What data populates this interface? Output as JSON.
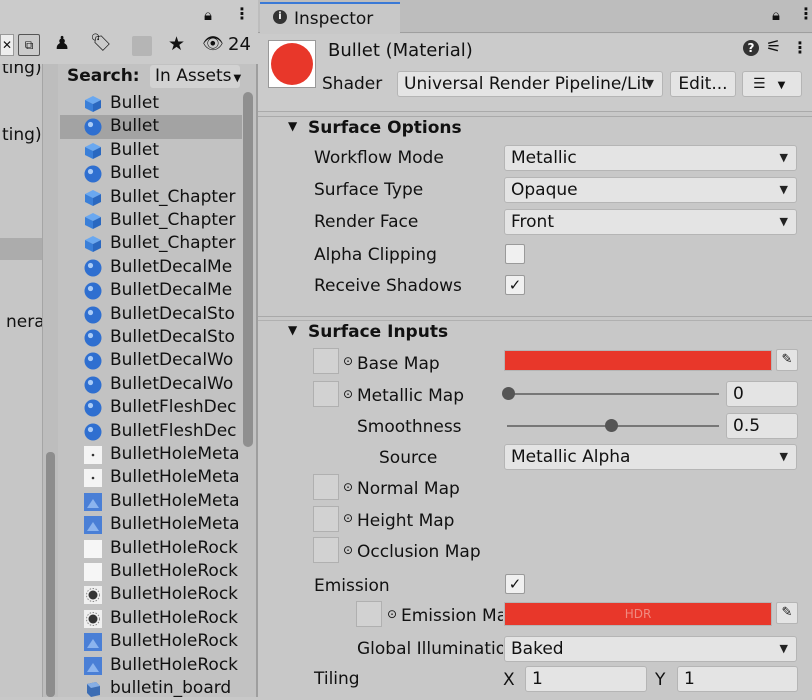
{
  "left": {
    "toolbar": {
      "hidden_count": "24"
    },
    "clipped_labels": [
      "ting)",
      "ting)",
      "nera"
    ],
    "search_label": "Search:",
    "search_scope": "In Assets",
    "assets": [
      {
        "name": "Bullet",
        "icon": "prefab-cube-icon"
      },
      {
        "name": "Bullet",
        "icon": "material-sphere-icon",
        "selected": true
      },
      {
        "name": "Bullet",
        "icon": "prefab-cube-icon"
      },
      {
        "name": "Bullet",
        "icon": "material-sphere-icon"
      },
      {
        "name": "Bullet_Chapter",
        "icon": "prefab-cube-icon"
      },
      {
        "name": "Bullet_Chapter",
        "icon": "prefab-cube-icon"
      },
      {
        "name": "Bullet_Chapter",
        "icon": "prefab-cube-icon"
      },
      {
        "name": "BulletDecalMe",
        "icon": "material-sphere-icon"
      },
      {
        "name": "BulletDecalMe",
        "icon": "material-sphere-icon"
      },
      {
        "name": "BulletDecalSto",
        "icon": "material-sphere-icon"
      },
      {
        "name": "BulletDecalSto",
        "icon": "material-sphere-icon"
      },
      {
        "name": "BulletDecalWo",
        "icon": "material-sphere-icon"
      },
      {
        "name": "BulletDecalWo",
        "icon": "material-sphere-icon"
      },
      {
        "name": "BulletFleshDec",
        "icon": "material-sphere-icon"
      },
      {
        "name": "BulletFleshDec",
        "icon": "material-sphere-icon"
      },
      {
        "name": "BulletHoleMeta",
        "icon": "texture-dot-icon"
      },
      {
        "name": "BulletHoleMeta",
        "icon": "texture-dot-icon"
      },
      {
        "name": "BulletHoleMeta",
        "icon": "texture-blue-icon"
      },
      {
        "name": "BulletHoleMeta",
        "icon": "texture-blue-icon"
      },
      {
        "name": "BulletHoleRock",
        "icon": "texture-white-icon"
      },
      {
        "name": "BulletHoleRock",
        "icon": "texture-white-icon"
      },
      {
        "name": "BulletHoleRock",
        "icon": "texture-hole-icon"
      },
      {
        "name": "BulletHoleRock",
        "icon": "texture-hole-icon"
      },
      {
        "name": "BulletHoleRock",
        "icon": "texture-blue-icon"
      },
      {
        "name": "BulletHoleRock",
        "icon": "texture-blue-icon"
      },
      {
        "name": "bulletin_board",
        "icon": "model-icon"
      }
    ]
  },
  "inspector": {
    "tab": "Inspector",
    "title": "Bullet (Material)",
    "shader_label": "Shader",
    "shader_value": "Universal Render Pipeline/Lit",
    "edit_button": "Edit...",
    "colors": {
      "albedo": "#e8372a",
      "emission": "#e8372a"
    },
    "surface_options": {
      "header": "Surface Options",
      "workflow_mode": {
        "label": "Workflow Mode",
        "value": "Metallic"
      },
      "surface_type": {
        "label": "Surface Type",
        "value": "Opaque"
      },
      "render_face": {
        "label": "Render Face",
        "value": "Front"
      },
      "alpha_clipping": {
        "label": "Alpha Clipping",
        "checked": false
      },
      "receive_shadows": {
        "label": "Receive Shadows",
        "checked": true
      }
    },
    "surface_inputs": {
      "header": "Surface Inputs",
      "base_map": {
        "label": "Base Map"
      },
      "metallic_map": {
        "label": "Metallic Map",
        "value": "0",
        "slider": 0
      },
      "smoothness": {
        "label": "Smoothness",
        "value": "0.5",
        "slider": 0.5
      },
      "source": {
        "label": "Source",
        "value": "Metallic Alpha"
      },
      "normal_map": {
        "label": "Normal Map"
      },
      "height_map": {
        "label": "Height Map"
      },
      "occlusion_map": {
        "label": "Occlusion Map"
      },
      "emission": {
        "label": "Emission",
        "checked": true
      },
      "emission_map": {
        "label": "Emission Ma",
        "hdr": "HDR"
      },
      "global_illumination": {
        "label": "Global Illuminatior",
        "value": "Baked"
      },
      "tiling": {
        "label": "Tiling",
        "x_label": "X",
        "x": "1",
        "y_label": "Y",
        "y": "1"
      }
    }
  }
}
